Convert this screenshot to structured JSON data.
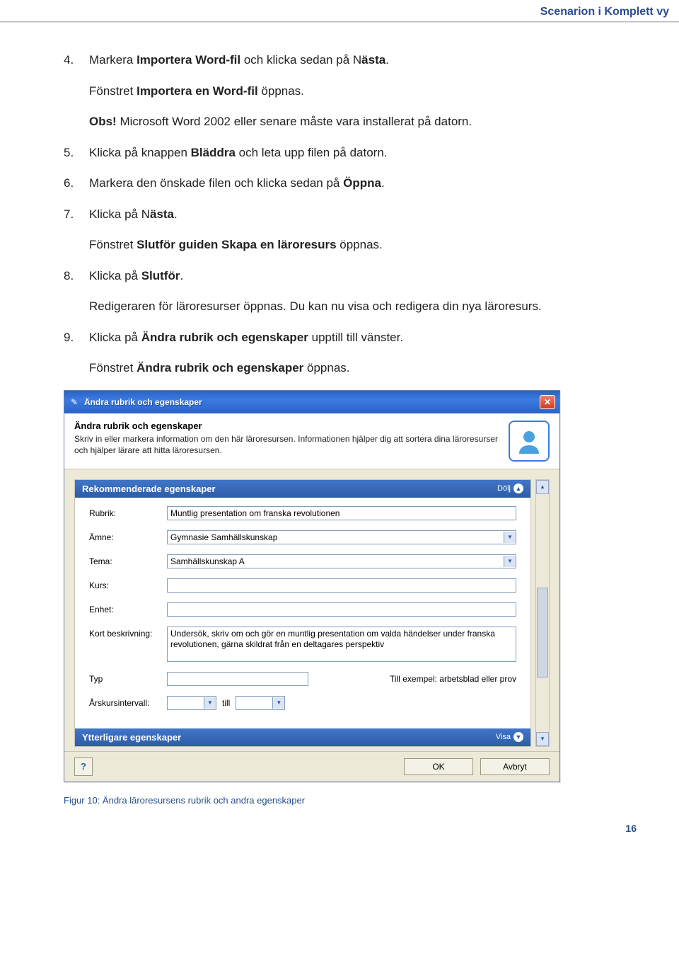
{
  "header": {
    "running_title": "Scenarion i Komplett vy"
  },
  "steps": {
    "s4_num": "4.",
    "s4_a": "Markera ",
    "s4_b": "Importera Word-fil",
    "s4_c": " och klicka sedan på N",
    "s4_d": "ästa",
    "s4_e": ".",
    "s4_sub_a": "Fönstret ",
    "s4_sub_b": "Importera en Word-fil",
    "s4_sub_c": " öppnas.",
    "s4_obs_a": "Obs!",
    "s4_obs_b": " Microsoft Word 2002 eller senare måste vara installerat på datorn.",
    "s5_num": "5.",
    "s5_a": "Klicka på knappen ",
    "s5_b": "Bläddra",
    "s5_c": " och leta upp filen på datorn.",
    "s6_num": "6.",
    "s6_a": "Markera den önskade filen och klicka sedan på ",
    "s6_b": "Öppna",
    "s6_c": ".",
    "s7_num": "7.",
    "s7_a": "Klicka på N",
    "s7_b": "ästa",
    "s7_c": ".",
    "s7_sub_a": "Fönstret ",
    "s7_sub_b": "Slutför guiden Skapa en läroresurs",
    "s7_sub_c": " öppnas.",
    "s8_num": "8.",
    "s8_a": "Klicka på ",
    "s8_b": "Slutför",
    "s8_c": ".",
    "s8_sub": "Redigeraren för läroresurser öppnas. Du kan nu visa och redigera din nya läroresurs.",
    "s9_num": "9.",
    "s9_a": "Klicka på ",
    "s9_b": "Ändra rubrik och egenskaper",
    "s9_c": " upptill till vänster.",
    "s9_sub_a": "Fönstret ",
    "s9_sub_b": "Ändra rubrik och egenskaper",
    "s9_sub_c": " öppnas."
  },
  "dialog": {
    "title": "Ändra rubrik och egenskaper",
    "header_title": "Ändra rubrik och egenskaper",
    "header_desc": "Skriv in eller markera information om den här läroresursen. Informationen hjälper dig att sortera dina läroresurser och hjälper lärare att hitta läroresursen.",
    "section_rec": "Rekommenderade egenskaper",
    "toggle_hide": "Dölj",
    "section_more": "Ytterligare egenskaper",
    "toggle_show": "Visa",
    "labels": {
      "rubrik": "Rubrik:",
      "amne": "Ämne:",
      "tema": "Tema:",
      "kurs": "Kurs:",
      "enhet": "Enhet:",
      "kort": "Kort beskrivning:",
      "typ": "Typ",
      "typ_hint": "Till exempel: arbetsblad eller prov",
      "arskurs": "Årskursintervall:",
      "till": "till"
    },
    "values": {
      "rubrik": "Muntlig presentation om franska revolutionen",
      "amne": "Gymnasie Samhällskunskap",
      "tema": "Samhällskunskap A",
      "kurs": "",
      "enhet": "",
      "kort": "Undersök, skriv om och gör en muntlig presentation om valda händelser under franska revolutionen, gärna skildrat från en deltagares perspektiv",
      "typ": "",
      "arskurs_from": "",
      "arskurs_to": ""
    },
    "buttons": {
      "ok": "OK",
      "cancel": "Avbryt"
    }
  },
  "caption": "Figur 10: Ändra läroresursens rubrik och andra egenskaper",
  "page_number": "16"
}
